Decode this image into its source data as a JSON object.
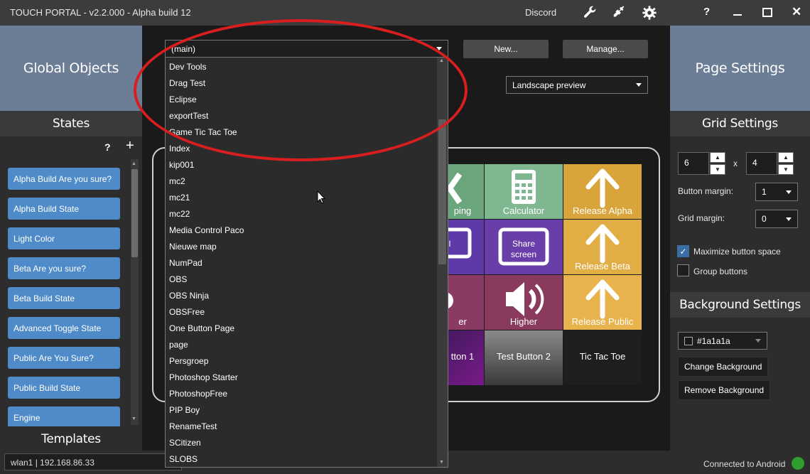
{
  "window": {
    "title": "TOUCH PORTAL - v2.2.000 - Alpha build 12",
    "discord": "Discord"
  },
  "left": {
    "global_objects": "Global Objects",
    "states_header": "States",
    "help_label": "?",
    "add_label": "+",
    "states": [
      "Alpha Build Are you sure?",
      "Alpha Build State",
      "Light Color",
      "Beta Are you sure?",
      "Beta Build State",
      "Advanced Toggle State",
      "Public Are You Sure?",
      "Public Build State",
      "Engine"
    ],
    "templates": "Templates"
  },
  "status": {
    "ip": "wlan1 | 192.168.86.33",
    "connection": "Connected to Android"
  },
  "center": {
    "page_select": "(main)",
    "new_button": "New...",
    "manage_button": "Manage...",
    "preview_select": "Landscape preview",
    "pages": [
      "Dev Tools",
      "Drag Test",
      "Eclipse",
      "exportTest",
      "Game Tic Tac Toe",
      "Index",
      "kip001",
      "mc2",
      "mc21",
      "mc22",
      "Media Control Paco",
      "Nieuwe map",
      "NumPad",
      "OBS",
      "OBS Ninja",
      "OBSFree",
      "One Button Page",
      "page",
      "Persgroep",
      "Photoshop Starter",
      "PhotoshopFree",
      "PIP Boy",
      "RenameTest",
      "SCitizen",
      "SLOBS"
    ],
    "tiles": {
      "t1": "ping",
      "t2": "Calculator",
      "t3": "Release Alpha",
      "t5": "Share screen",
      "t6": "Release Beta",
      "t7": "er",
      "t8": "Higher",
      "t9": "Release Public",
      "t10": "tton 1",
      "t11": "Test Button 2",
      "t12": "Tic Tac Toe"
    }
  },
  "right": {
    "page_settings": "Page Settings",
    "grid_settings": "Grid Settings",
    "cols": "6",
    "rows": "4",
    "x_sep": "x",
    "button_margin_label": "Button margin:",
    "button_margin": "1",
    "grid_margin_label": "Grid margin:",
    "grid_margin": "0",
    "maximize_label": "Maximize button space",
    "group_label": "Group buttons",
    "checkmark": "✓",
    "background_settings": "Background Settings",
    "bg_color": "#1a1a1a",
    "change_bg": "Change Background",
    "remove_bg": "Remove Background"
  },
  "colors": {
    "title_bar": "#3c3c3c",
    "header_blue": "#6c7d96",
    "state_button": "#4f8bc9",
    "annotation_red": "#d81e1e",
    "connected_green": "#2e9e2e"
  }
}
